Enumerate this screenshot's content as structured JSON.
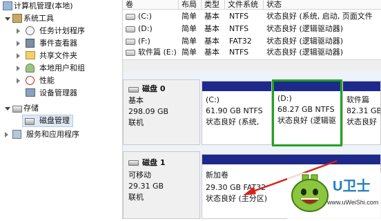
{
  "tree": {
    "root": "计算机管理(本地)",
    "system_tools": "系统工具",
    "task_scheduler": "任务计划程序",
    "event_viewer": "事件查看器",
    "shared_folders": "共享文件夹",
    "local_users": "本地用户和组",
    "performance": "性能",
    "device_manager": "设备管理器",
    "storage": "存储",
    "disk_management": "磁盘管理",
    "services_apps": "服务和应用程序"
  },
  "volumes": {
    "headers": [
      "卷",
      "布局",
      "类型",
      "文件系统",
      "状态"
    ],
    "rows": [
      {
        "name": "(C:)",
        "layout": "简单",
        "type": "基本",
        "fs": "NTFS",
        "status": "状态良好 (系统, 启动, 页面文件"
      },
      {
        "name": "(D:)",
        "layout": "简单",
        "type": "基本",
        "fs": "NTFS",
        "status": "状态良好 (逻辑驱动器)"
      },
      {
        "name": "(F:)",
        "layout": "简单",
        "type": "基本",
        "fs": "FAT32",
        "status": "状态良好 (逻辑驱动器)"
      },
      {
        "name": "软件篇 (E:)",
        "layout": "简单",
        "type": "基本",
        "fs": "NTFS",
        "status": "状态良好 (逻辑驱动器)"
      }
    ]
  },
  "disk0": {
    "name": "磁盘 0",
    "type": "基本",
    "size": "298.09 GB",
    "state": "联机",
    "partitions": [
      {
        "title": "(C:)",
        "size": "61.90 GB NTFS",
        "status": "状态良好 (系统,"
      },
      {
        "title": "(D:)",
        "size": "68.27 GB NTFS",
        "status": "状态良好 (逻辑驱"
      },
      {
        "title": "软件篇",
        "size": "82.31 GB",
        "status": "状态良好"
      }
    ]
  },
  "disk1": {
    "name": "磁盘 1",
    "type": "可移动",
    "size": "29.31 GB",
    "state": "联机",
    "partition": {
      "title": "新加卷",
      "size": "29.30 GB FAT32",
      "status": "状态良好 (主分区)"
    }
  },
  "logo": {
    "brand": "U卫士",
    "url": "www.uWeiShi.com"
  },
  "colors": {
    "partition_bar": "#1d2a8c",
    "selected_green": "#22a31f",
    "arrow_red": "#d9221b"
  }
}
